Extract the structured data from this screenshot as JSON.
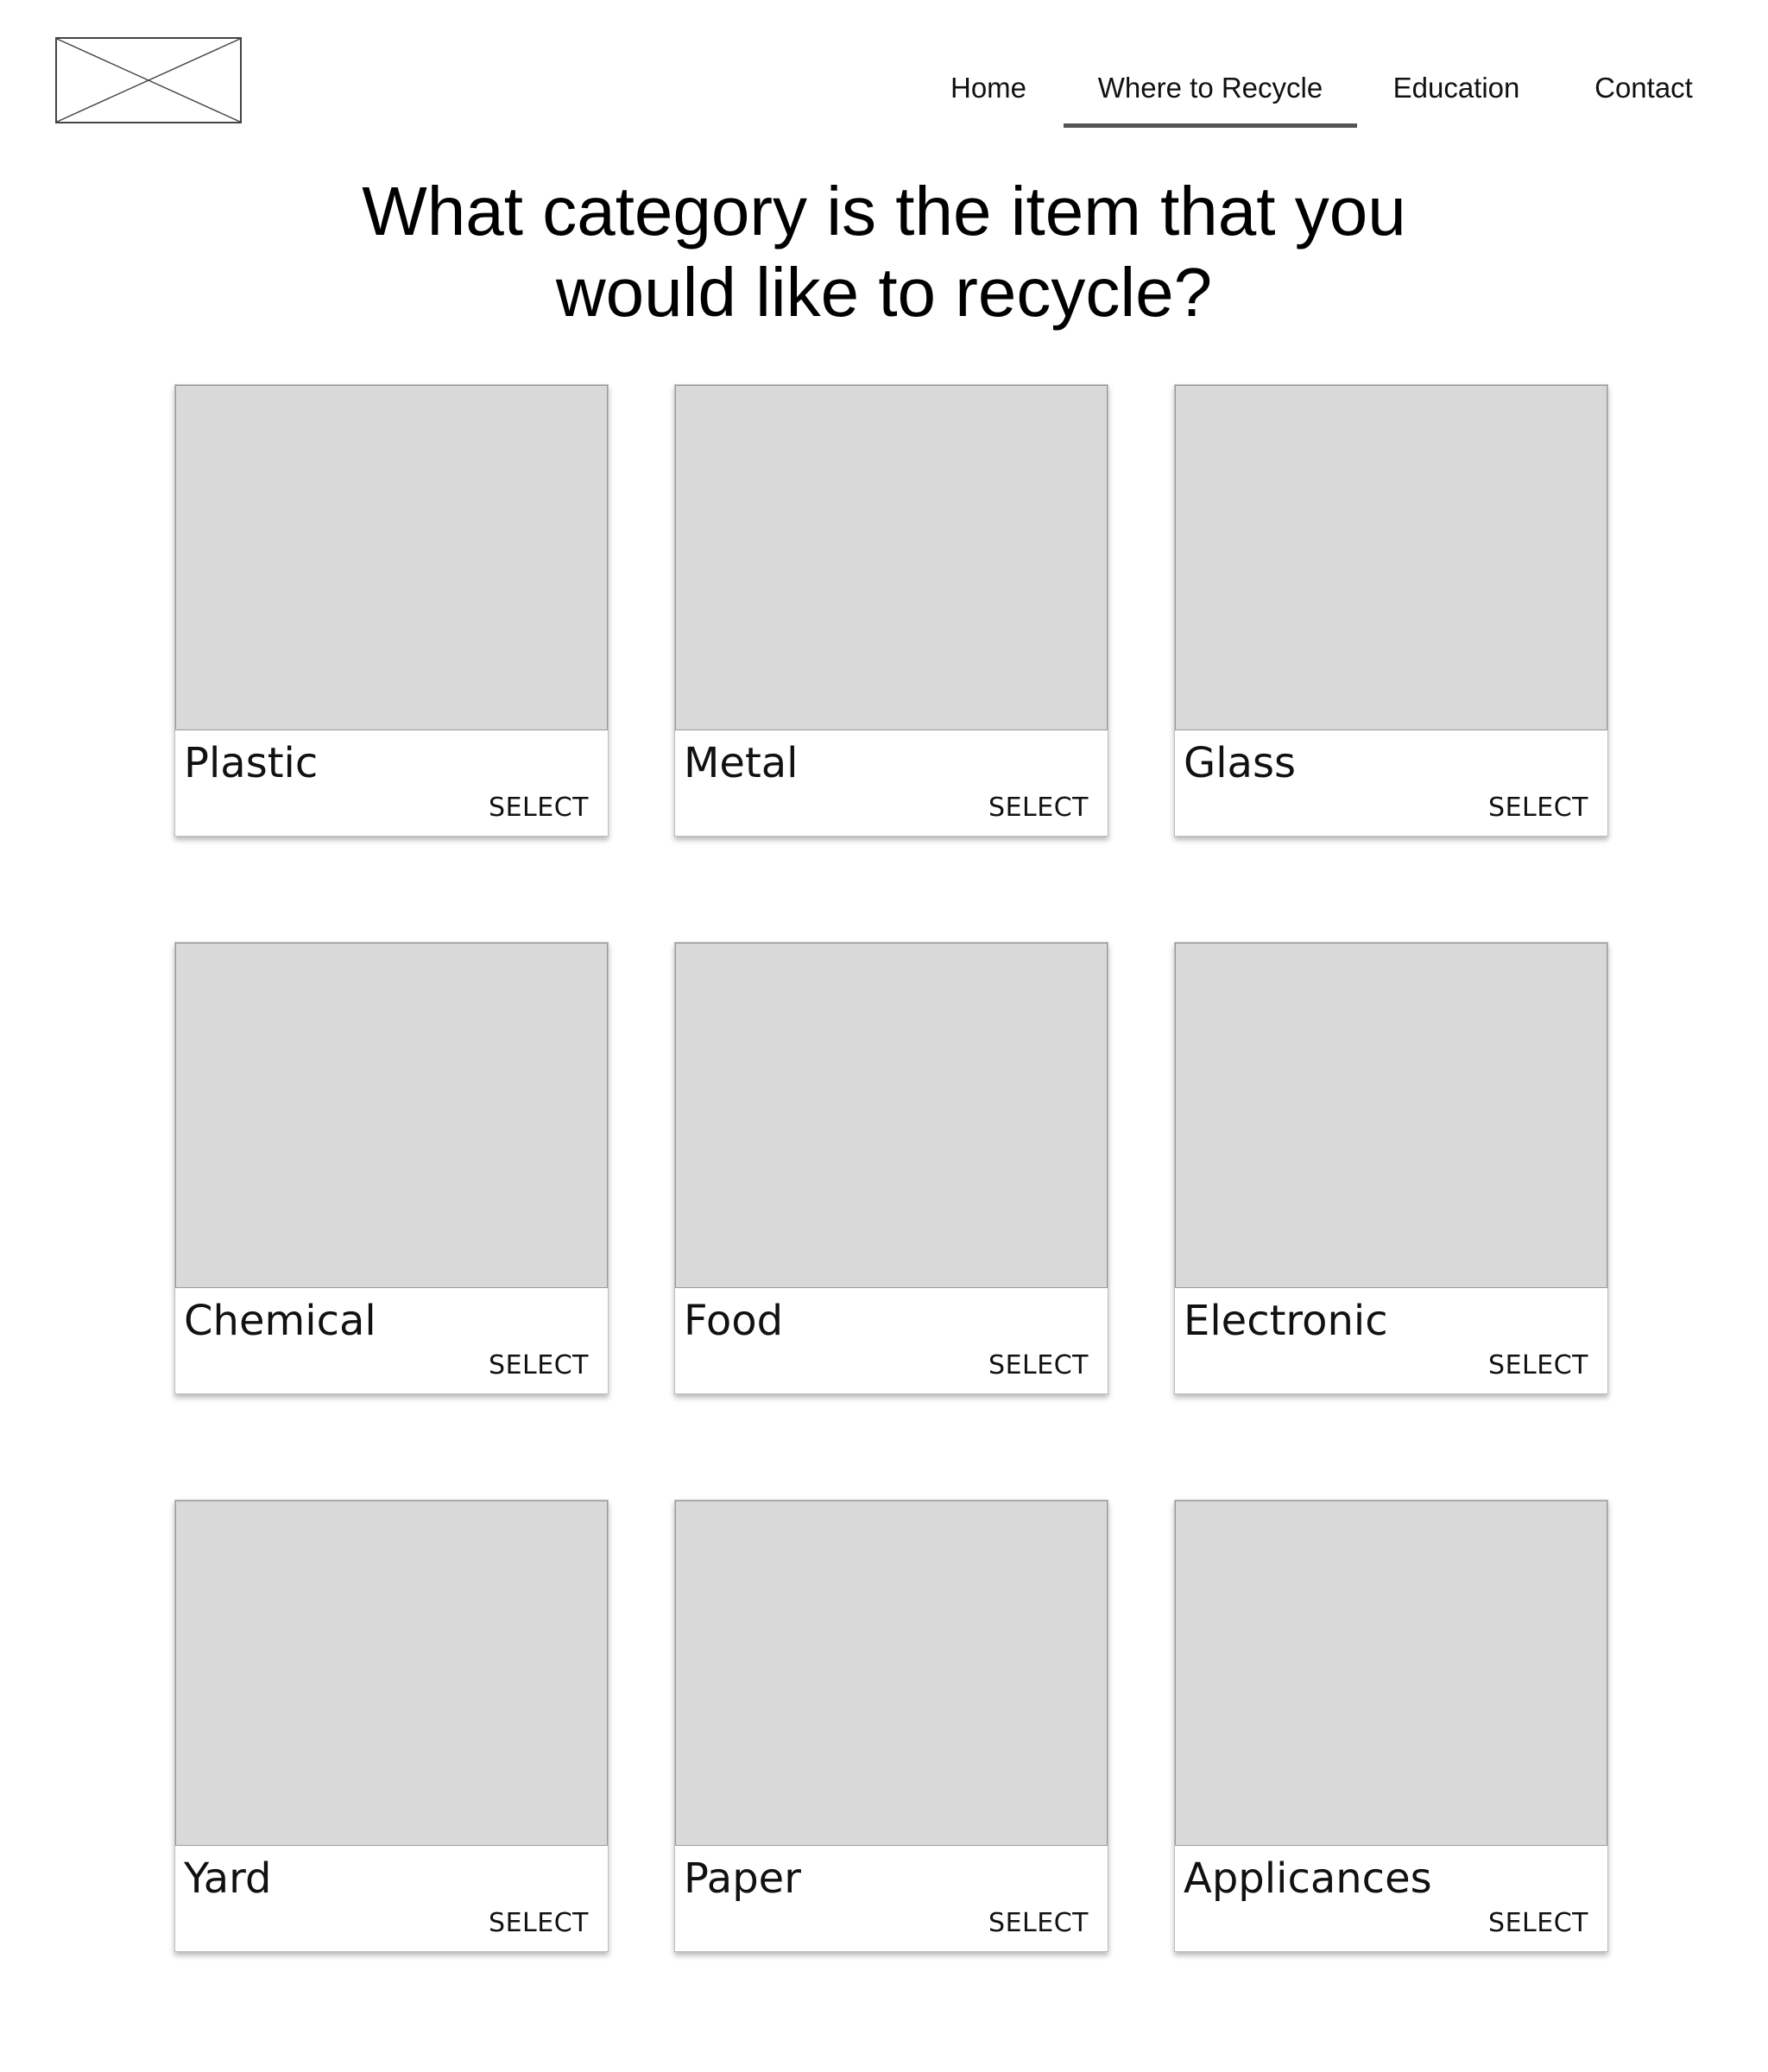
{
  "header": {
    "logo_icon": "image-placeholder-icon",
    "nav": [
      {
        "label": "Home",
        "active": false
      },
      {
        "label": "Where to Recycle",
        "active": true
      },
      {
        "label": "Education",
        "active": false
      },
      {
        "label": "Contact",
        "active": false
      }
    ]
  },
  "main": {
    "title_line1": "What category is the item that you",
    "title_line2": "would like to recycle?",
    "categories": [
      {
        "name": "Plastic",
        "action": "SELECT"
      },
      {
        "name": "Metal",
        "action": "SELECT"
      },
      {
        "name": "Glass",
        "action": "SELECT"
      },
      {
        "name": "Chemical",
        "action": "SELECT"
      },
      {
        "name": "Food",
        "action": "SELECT"
      },
      {
        "name": "Electronic",
        "action": "SELECT"
      },
      {
        "name": "Yard",
        "action": "SELECT"
      },
      {
        "name": "Paper",
        "action": "SELECT"
      },
      {
        "name": "Applicances",
        "action": "SELECT"
      }
    ]
  },
  "colors": {
    "placeholder": "#d9d9d9",
    "active_underline": "#555555",
    "text": "#111111"
  }
}
